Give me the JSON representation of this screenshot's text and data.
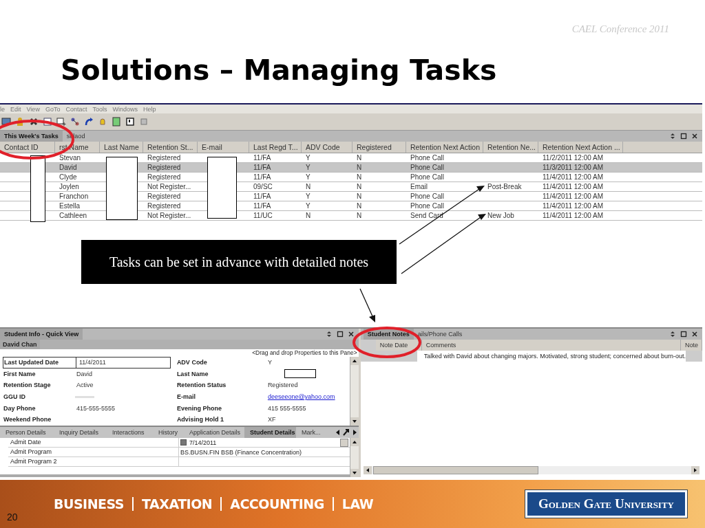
{
  "slide": {
    "conference": "CAEL Conference 2011",
    "title": "Solutions – Managing Tasks",
    "page_number": "20"
  },
  "menu": [
    "le",
    "Edit",
    "View",
    "GoTo",
    "Contact",
    "Tools",
    "Windows",
    "Help"
  ],
  "tasks_panel": {
    "tabs": [
      {
        "label": "This Week's Tasks",
        "selected": true
      },
      {
        "label": "selaod",
        "selected": false
      }
    ],
    "columns": [
      "Contact ID",
      "rst Name",
      "Last Name",
      "Retention St...",
      "E-mail",
      "Last Regd T...",
      "ADV Code",
      "Registered",
      "Retention Next Action",
      "Retention Ne...",
      "Retention Next Action ..."
    ],
    "rows": [
      {
        "first_name": "Stevan",
        "retention_status": "Registered",
        "last_regd": "11/FA",
        "adv_code": "Y",
        "registered": "N",
        "next_action": "Phone Call",
        "next_note": "",
        "next_date": "11/2/2011 12:00 AM",
        "selected": false
      },
      {
        "first_name": "David",
        "retention_status": "Registered",
        "last_regd": "11/FA",
        "adv_code": "Y",
        "registered": "N",
        "next_action": "Phone Call",
        "next_note": "",
        "next_date": "11/3/2011 12:00 AM",
        "selected": true
      },
      {
        "first_name": "Clyde",
        "retention_status": "Registered",
        "last_regd": "11/FA",
        "adv_code": "Y",
        "registered": "N",
        "next_action": "Phone Call",
        "next_note": "",
        "next_date": "11/4/2011 12:00 AM",
        "selected": false
      },
      {
        "first_name": "Joylen",
        "retention_status": "Not Register...",
        "last_regd": "09/SC",
        "adv_code": "N",
        "registered": "N",
        "next_action": "Email",
        "next_note": "Post-Break",
        "next_date": "11/4/2011 12:00 AM",
        "selected": false
      },
      {
        "first_name": "Franchon",
        "retention_status": "Registered",
        "last_regd": "11/FA",
        "adv_code": "Y",
        "registered": "N",
        "next_action": "Phone Call",
        "next_note": "",
        "next_date": "11/4/2011 12:00 AM",
        "selected": false
      },
      {
        "first_name": "Estella",
        "retention_status": "Registered",
        "last_regd": "11/FA",
        "adv_code": "Y",
        "registered": "N",
        "next_action": "Phone Call",
        "next_note": "",
        "next_date": "11/4/2011 12:00 AM",
        "selected": false
      },
      {
        "first_name": "Cathleen",
        "retention_status": "Not Register...",
        "last_regd": "11/UC",
        "adv_code": "N",
        "registered": "N",
        "next_action": "Send Card",
        "next_note": "New Job",
        "next_date": "11/4/2011 12:00 AM",
        "selected": false
      }
    ]
  },
  "callout": "Tasks can be set in advance with detailed notes",
  "student_info": {
    "title": "Student Info - Quick View",
    "student_name": "David Chan",
    "hint": "<Drag and drop Properties to this Pane>",
    "fields": [
      {
        "label": "Last Updated Date",
        "value": "11/4/2011",
        "kind": "focused"
      },
      {
        "label": "ADV Code",
        "value": "Y",
        "kind": "text"
      },
      {
        "label": "First Name",
        "value": "David",
        "kind": "text"
      },
      {
        "label": "Last Name",
        "kind": "redacted"
      },
      {
        "label": "Retention Stage",
        "value": "Active",
        "kind": "text"
      },
      {
        "label": "Retention Status",
        "value": "Registered",
        "kind": "text"
      },
      {
        "label": "GGU ID",
        "kind": "blurred"
      },
      {
        "label": "E-mail",
        "value": "deeseeone@yahoo.com",
        "kind": "link"
      },
      {
        "label": "Day Phone",
        "value": "415-555-5555",
        "kind": "text"
      },
      {
        "label": "Evening Phone",
        "value": "415 555-5555",
        "kind": "text"
      },
      {
        "label": "Weekend Phone",
        "kind": "text"
      },
      {
        "label": "Advising Hold 1",
        "value": "XF",
        "kind": "text"
      }
    ],
    "tabs": [
      {
        "label": "Person Details",
        "selected": false
      },
      {
        "label": "Inquiry Details",
        "selected": false
      },
      {
        "label": "Interactions",
        "selected": false
      },
      {
        "label": "History",
        "selected": false
      },
      {
        "label": "Application Details",
        "selected": false
      },
      {
        "label": "Student Details",
        "selected": true
      },
      {
        "label": "Mark...",
        "selected": false
      }
    ],
    "details": [
      {
        "label": "Admit Date",
        "value": "7/14/2011",
        "kind": "date",
        "checked": true
      },
      {
        "label": "Admit Program",
        "value": "BS.BUSN.FIN  BSB (Finance Concentration)",
        "kind": "text"
      },
      {
        "label": "Admit Program 2",
        "kind": "text"
      }
    ]
  },
  "notes_panel": {
    "tabs": [
      {
        "label": "Student Notes",
        "selected": true
      },
      {
        "label": "ails/Phone Calls",
        "selected": false
      }
    ],
    "columns": [
      "Note Date",
      "Comments",
      "Note"
    ],
    "rows": [
      {
        "comment": "Talked with David about changing majors. Motivated, strong student; concerned about burn-out."
      }
    ]
  },
  "footer": {
    "disciplines": [
      "BUSINESS",
      "TAXATION",
      "ACCOUNTING",
      "LAW"
    ],
    "logo": "Golden Gate University"
  }
}
